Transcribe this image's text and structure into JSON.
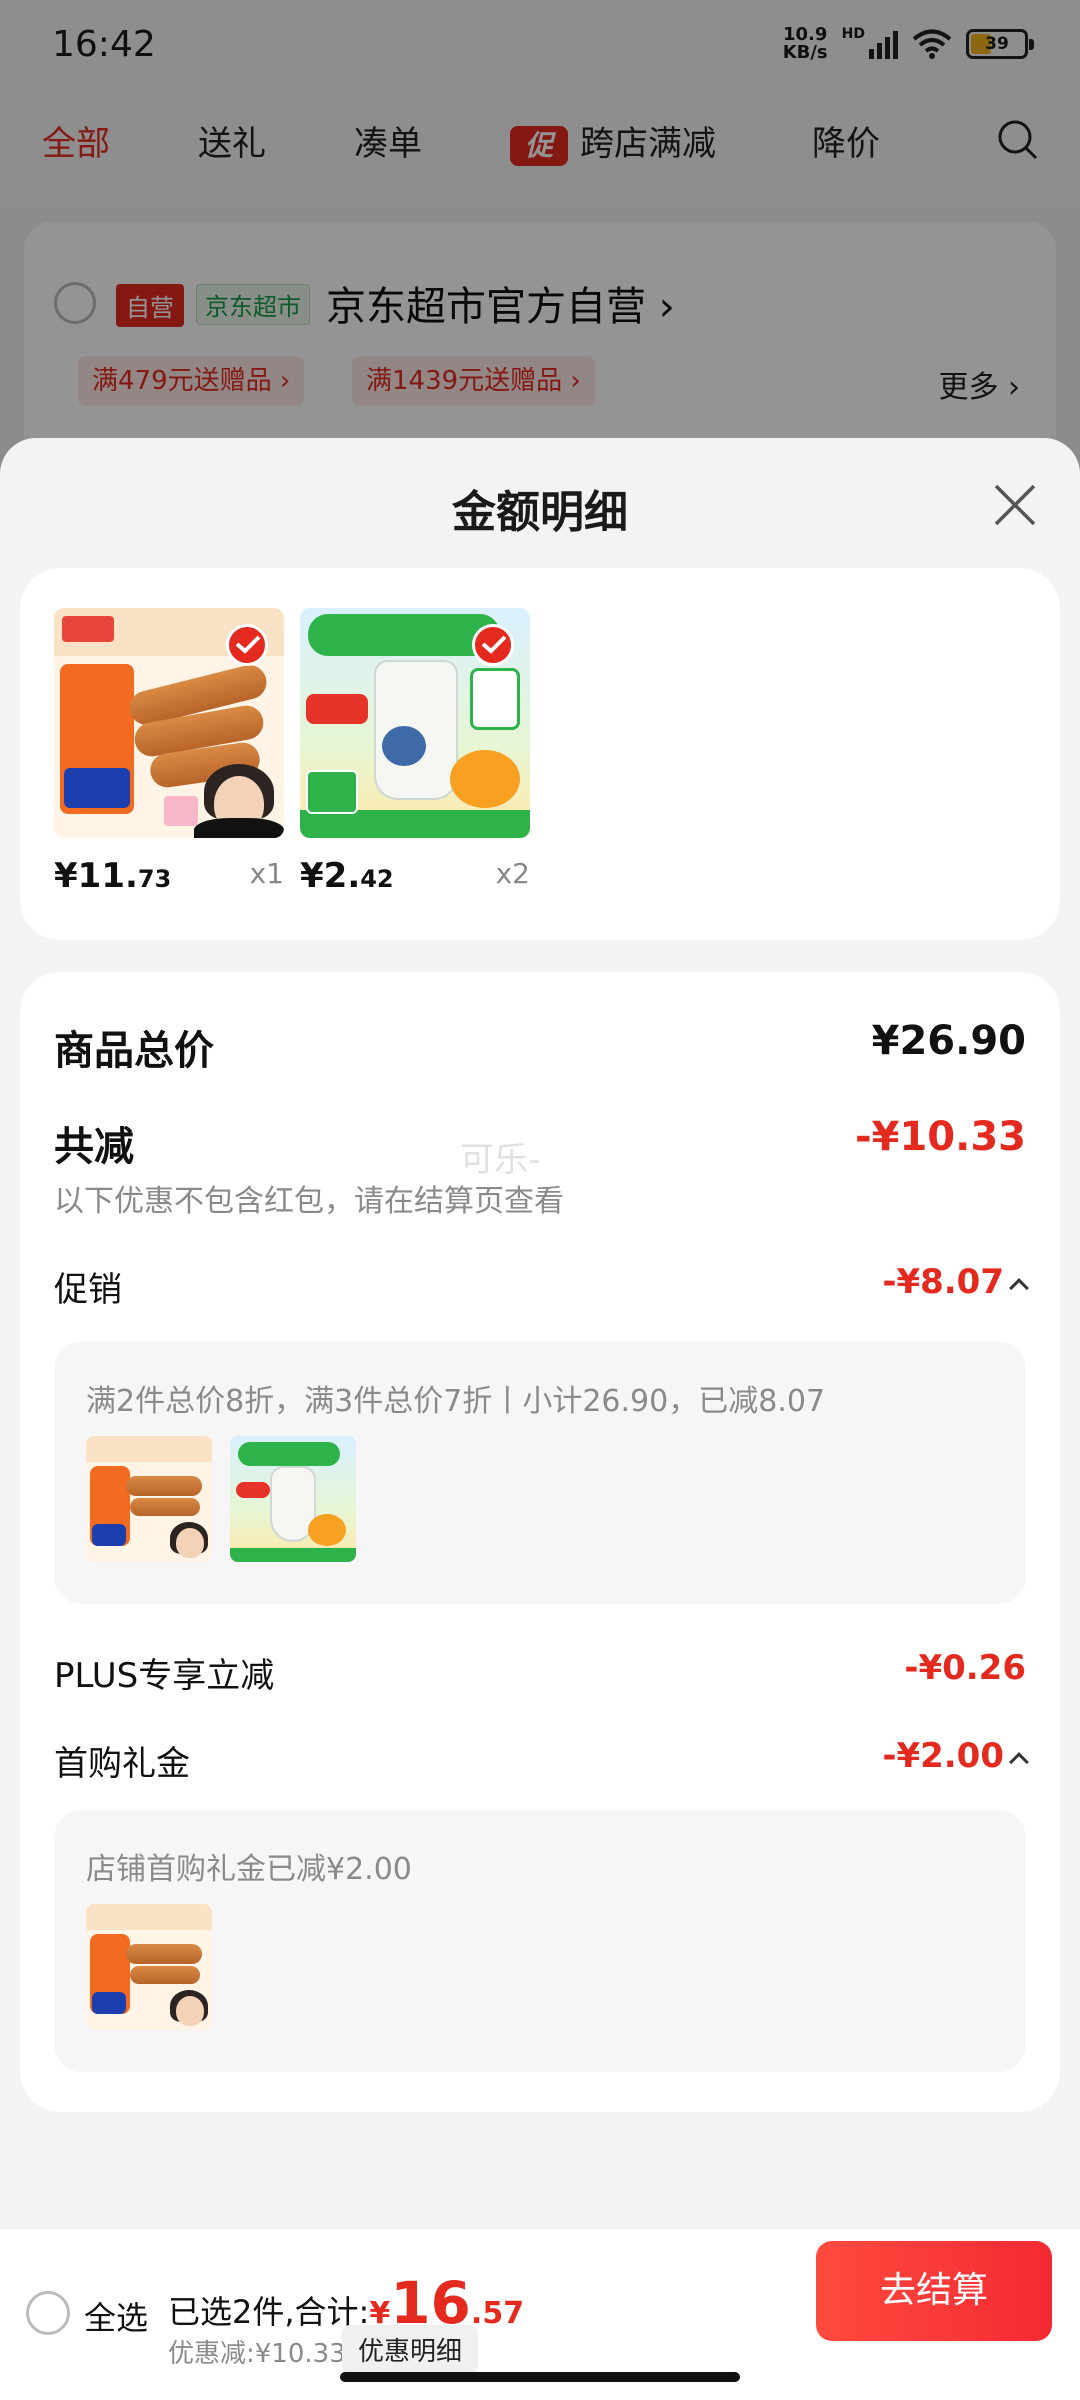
{
  "status": {
    "time": "16:42",
    "net_speed_value": "10.9",
    "net_speed_unit": "KB/s",
    "network": "HD",
    "battery": "39"
  },
  "tabs": [
    {
      "label": "全部",
      "active": true
    },
    {
      "label": "送礼"
    },
    {
      "label": "凑单"
    },
    {
      "label": "跨店满减",
      "badge": "促"
    },
    {
      "label": "降价"
    }
  ],
  "shop": {
    "tag_self": "自营",
    "tag_market": "京东超市",
    "name": "京东超市官方自营",
    "coupons": [
      "满479元送赠品",
      "满1439元送赠品"
    ],
    "more": "更多"
  },
  "sheet": {
    "title": "金额明细",
    "goods": [
      {
        "price_int": "¥11.",
        "price_dec": "73",
        "qty": "x1"
      },
      {
        "price_int": "¥2.",
        "price_dec": "42",
        "qty": "x2"
      }
    ],
    "total_label": "商品总价",
    "total_value": "¥26.90",
    "discount_label": "共减",
    "discount_value": "-¥10.33",
    "discount_note": "以下优惠不包含红包，请在结算页查看",
    "watermark": "可乐-",
    "promo_label": "促销",
    "promo_value": "-¥8.07",
    "promo_desc": "满2件总价8折，满3件总价7折丨小计26.90，已减8.07",
    "plus_label": "PLUS专享立减",
    "plus_value": "-¥0.26",
    "gift_label": "首购礼金",
    "gift_value": "-¥2.00",
    "gift_desc": "店铺首购礼金已减¥2.00"
  },
  "bottom": {
    "select_all": "全选",
    "selected_text": "已选2件,合计:",
    "yen": "¥",
    "total_int": "16",
    "total_dec": ".57",
    "saved": "优惠减:¥10.33",
    "detail_button": "优惠明细",
    "checkout": "去结算"
  }
}
